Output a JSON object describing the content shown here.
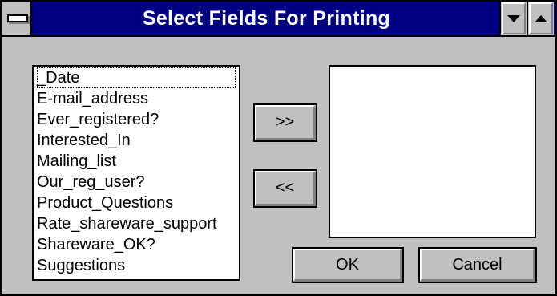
{
  "window": {
    "title": "Select Fields For Printing"
  },
  "available_fields": [
    "_Date",
    "E-mail_address",
    "Ever_registered?",
    "Interested_In",
    "Mailing_list",
    "Our_reg_user?",
    "Product_Questions",
    "Rate_shareware_support",
    "Shareware_OK?",
    "Suggestions"
  ],
  "selected_fields": [],
  "buttons": {
    "add": ">>",
    "remove": "<<",
    "ok": "OK",
    "cancel": "Cancel"
  },
  "icons": {
    "system_menu": "system-menu-icon",
    "minimize": "minimize-arrow-icon",
    "maximize": "maximize-arrow-icon"
  }
}
